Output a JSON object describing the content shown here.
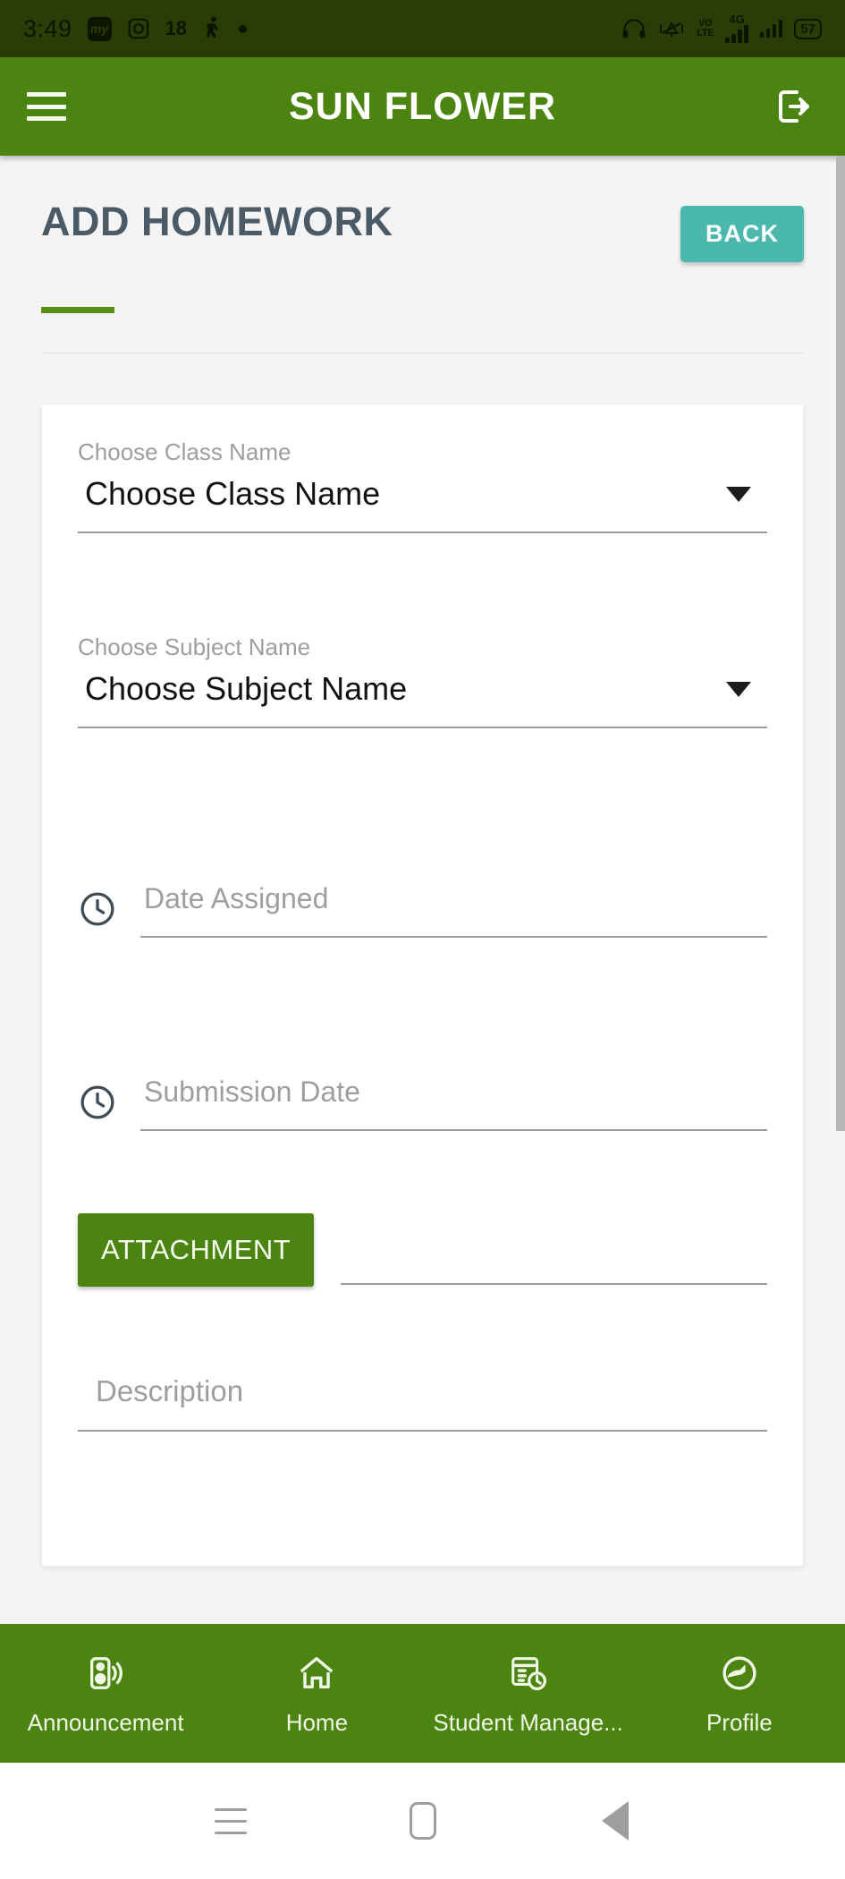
{
  "status_bar": {
    "time": "3:49",
    "left_icons": [
      "my-app-icon",
      "instagram-icon",
      "walking-icon",
      "dot-icon"
    ],
    "notification_count": "18",
    "app_badge_text": "my",
    "right_icons": [
      "headphones-icon",
      "vibrate-icon",
      "signal-bars-icon",
      "signal-bars-2-icon"
    ],
    "volte_label": "VoLTE",
    "network_label": "4G",
    "battery_level": "57"
  },
  "app_bar": {
    "title": "SUN FLOWER",
    "menu_icon": "hamburger-menu-icon",
    "logout_icon": "logout-icon",
    "background_color": "#4b8410"
  },
  "page": {
    "title": "ADD HOMEWORK",
    "back_label": "BACK",
    "back_color": "#4bb8ad",
    "accent_color": "#5a8f12"
  },
  "form": {
    "class": {
      "label": "Choose Class Name",
      "value": "Choose Class Name",
      "caret_icon": "chevron-down-icon"
    },
    "subject": {
      "label": "Choose Subject Name",
      "value": "Choose Subject Name",
      "caret_icon": "chevron-down-icon"
    },
    "date_assigned": {
      "placeholder": "Date Assigned",
      "value": "",
      "icon": "clock-icon"
    },
    "submission_date": {
      "placeholder": "Submission Date",
      "value": "",
      "icon": "clock-icon"
    },
    "attachment": {
      "button_label": "ATTACHMENT",
      "button_color": "#4b8410",
      "file_value": ""
    },
    "description": {
      "placeholder": "Description",
      "value": ""
    }
  },
  "bottom_nav": {
    "items": [
      {
        "label": "Announcement",
        "icon": "announcement-speaker-icon"
      },
      {
        "label": "Home",
        "icon": "home-icon"
      },
      {
        "label": "Student Manage...",
        "icon": "student-management-schedule-icon"
      },
      {
        "label": "Profile",
        "icon": "profile-avatar-icon"
      }
    ]
  },
  "android_nav": {
    "recents_icon": "recents-icon",
    "home_icon": "home-square-icon",
    "back_icon": "back-triangle-icon"
  }
}
